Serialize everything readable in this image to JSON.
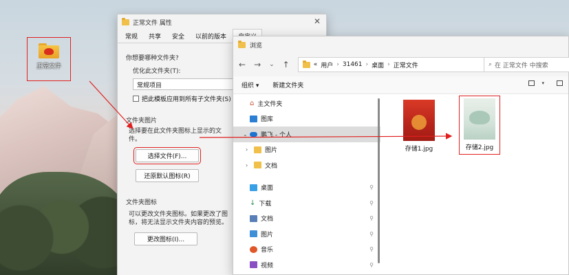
{
  "desktop": {
    "folder_label": "正常文件"
  },
  "props_dialog": {
    "title": "正常文件 属性",
    "tabs": [
      "常规",
      "共享",
      "安全",
      "以前的版本",
      "自定义"
    ],
    "question": "你想要哪种文件夹?",
    "optimize_label": "优化此文件夹(T):",
    "optimize_value": "常规项目",
    "apply_sub_label": "把此模板应用到所有子文件夹(S)",
    "folder_pic_group": "文件夹图片",
    "folder_pic_desc": "选择要在此文件夹图标上显示的文件。",
    "choose_file_btn": "选择文件(F)...",
    "restore_default_btn": "还原默认图标(R)",
    "folder_icon_group": "文件夹图标",
    "folder_icon_desc": "可以更改文件夹图标。如果更改了图标，将无法显示文件夹内容的预览。",
    "change_icon_btn": "更改图标(I)..."
  },
  "browse_dialog": {
    "title": "浏览",
    "breadcrumb": [
      "«",
      "用户",
      "31461",
      "桌面",
      "正常文件"
    ],
    "search_placeholder": "在 正常文件 中搜索",
    "organize_label": "组织",
    "new_folder_label": "新建文件夹",
    "nav_items": [
      {
        "label": "主文件夹",
        "icon": "home-icon"
      },
      {
        "label": "图库",
        "icon": "gallery-icon"
      },
      {
        "label": "鹏飞 - 个人",
        "icon": "cloud-icon",
        "selected": true
      },
      {
        "label": "图片",
        "icon": "folder-icon"
      },
      {
        "label": "文档",
        "icon": "folder-icon"
      },
      {
        "label": "桌面",
        "icon": "desktop-icon",
        "pinned": true
      },
      {
        "label": "下载",
        "icon": "download-icon",
        "pinned": true
      },
      {
        "label": "文档",
        "icon": "document-icon",
        "pinned": true
      },
      {
        "label": "图片",
        "icon": "picture-icon",
        "pinned": true
      },
      {
        "label": "音乐",
        "icon": "music-icon",
        "pinned": true
      },
      {
        "label": "视频",
        "icon": "video-icon",
        "pinned": true
      }
    ],
    "files": [
      {
        "name": "存储1.jpg"
      },
      {
        "name": "存储2.jpg"
      }
    ]
  },
  "colors": {
    "highlight": "#e0201f",
    "accent": "#0a64c8",
    "folder": "#f0c04a"
  }
}
